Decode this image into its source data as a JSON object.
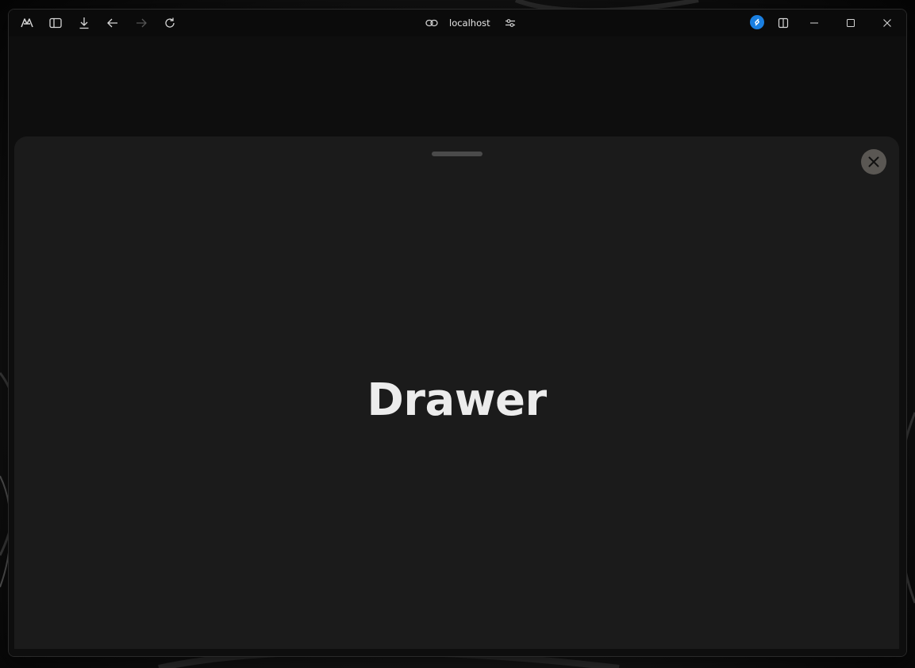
{
  "browser": {
    "address_url": "localhost",
    "icons": {
      "app_logo": "browser-logo-icon",
      "sidebar_toggle": "sidebar-icon",
      "downloads": "download-icon",
      "back": "arrow-left-icon",
      "forward": "arrow-right-icon",
      "reload": "reload-icon",
      "site_info": "link-icon",
      "site_settings": "tune-icon",
      "extension": "shazam-icon",
      "split_view": "split-view-icon",
      "minimize": "minimize-icon",
      "maximize": "maximize-icon",
      "close": "close-icon"
    },
    "forward_enabled": false
  },
  "drawer": {
    "title": "Drawer",
    "close_icon": "close-icon"
  },
  "colors": {
    "drawer_background": "#1b1b1b",
    "close_button_background": "#5a5753",
    "extension_badge": "#1a7fe0"
  }
}
